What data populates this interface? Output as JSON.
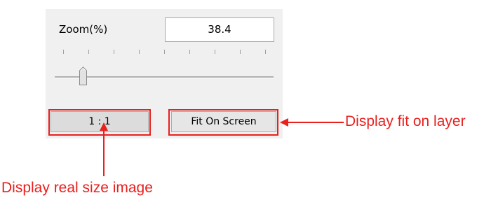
{
  "zoom": {
    "label": "Zoom(%)",
    "value": "38.4",
    "slider_level": 0.1
  },
  "buttons": {
    "real_size_label": "1 : 1",
    "fit_label": "Fit On Screen"
  },
  "annotations": {
    "fit_note": "Display fit on layer",
    "real_note": "Display real size image",
    "color": "#e8201e"
  },
  "panel_color": "#f0f0f0"
}
